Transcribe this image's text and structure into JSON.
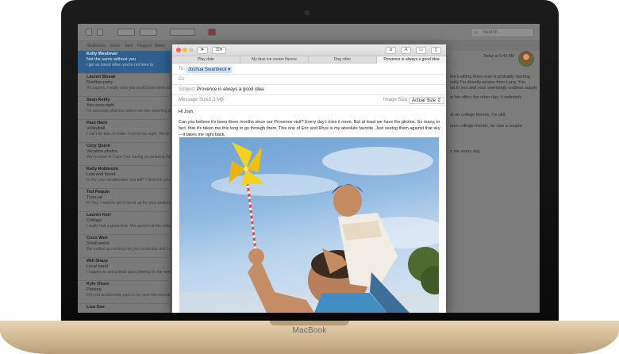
{
  "device": {
    "brand": "MacBook"
  },
  "mail": {
    "toolbar": {
      "favorites": [
        "Mailboxes",
        "Inbox",
        "Sent",
        "Flagged",
        "Notes"
      ],
      "search_placeholder": "Search"
    },
    "messages": [
      {
        "sender": "Kelly Westover",
        "subject": "Not the same without you",
        "preview": "I get so bored when you're not here to",
        "selected": true
      },
      {
        "sender": "Lauren Bosak",
        "subject": "Rooftop party",
        "preview": "Hi, Lauren. I really wish you could have been at the",
        "selected": false
      },
      {
        "sender": "Sean Reilly",
        "subject": "You were right",
        "preview": "I'm seriously glad you talked me into watching the movie",
        "selected": false
      },
      {
        "sender": "Paul Hack",
        "subject": "Volleyball",
        "preview": "I can't be able to make it tomorrow night. We're going to",
        "selected": false
      },
      {
        "sender": "Cory Quinn",
        "subject": "Vacation photos",
        "preview": "We've been in Cape Cod having an amazing time. I'm",
        "selected": false
      },
      {
        "sender": "Kelly Robinson",
        "subject": "Lost and found",
        "preview": "Is this your windbreaker you left? I think it's you have it",
        "selected": false
      },
      {
        "sender": "Ted Paquin",
        "subject": "Tune-up",
        "preview": "Hi Ted, I need to get it tuned up for your weekend ride?",
        "selected": false
      },
      {
        "sender": "Lauren Kerr",
        "subject": "Cottage",
        "preview": "I really had a great time. We spent it at the cottage",
        "selected": false
      },
      {
        "sender": "Coco Weir",
        "subject": "Small world",
        "preview": "We ended up running into you yesterday and I completely",
        "selected": false
      },
      {
        "sender": "Will Sharp",
        "subject": "Local band",
        "preview": "I happen to see a local band playing for the weekend",
        "selected": false
      },
      {
        "sender": "Kyle Olsen",
        "subject": "Parking",
        "preview": "Did you accidentally park in my spot this morning?",
        "selected": false
      },
      {
        "sender": "Lisa Gee",
        "subject": "",
        "preview": "",
        "selected": false
      }
    ],
    "reading_pane": {
      "date": "Today at 9:40 AM",
      "lines": [
        "me's sitting there now is probably starting",
        "ually I'm directly across from Larry. You",
        "nd to you and your seemingly endless supply",
        "in his office the other day. It definitely",
        "ut on college friends, I'm still",
        "nom college friends, he saw a couple",
        "n me every day."
      ]
    }
  },
  "compose": {
    "tabs": [
      "Play date",
      "My fave ice cream flavors",
      "Dog sitter",
      "Provence is always a good idea"
    ],
    "active_tab": 3,
    "to_label": "To:",
    "to_value": "Joshua Swanbeck",
    "cc_label": "Cc:",
    "subject_label": "Subject:",
    "subject_value": "Provence is always a good idea",
    "message_size_label": "Message Size:",
    "message_size_value": "2.3 MB",
    "image_size_label": "Image Size:",
    "image_size_value": "Actual Size",
    "greeting": "Hi Josh,",
    "body": "Can you believe it's been three months since our Provence visit? Every day I miss it more. But at least we have the photos. So many, in fact, that it's taken me this long to go through them. This one of Eric and Rhys is my absolute favorite. Just seeing them against that sky—it takes me right back."
  },
  "colors": {
    "accent": "#2f5f8f",
    "close": "#fc605c",
    "minimize": "#fdbc40",
    "maximize": "#34c84a",
    "gold": "#d9c29f"
  }
}
